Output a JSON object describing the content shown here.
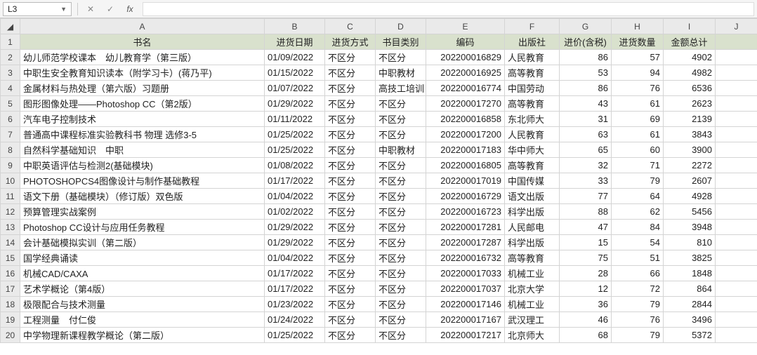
{
  "formula_bar": {
    "name_box": "L3",
    "cancel_glyph": "✕",
    "confirm_glyph": "✓",
    "fx_label": "fx",
    "formula_value": ""
  },
  "col_headers": [
    "A",
    "B",
    "C",
    "D",
    "E",
    "F",
    "G",
    "H",
    "I",
    "J"
  ],
  "data_header": [
    "书名",
    "进货日期",
    "进货方式",
    "书目类别",
    "编码",
    "出版社",
    "进价(含税)",
    "进货数量",
    "金额总计"
  ],
  "rows": [
    {
      "n": 2,
      "name": "幼儿师范学校课本　幼儿教育学（第三版）",
      "date": "01/09/2022",
      "way": "不区分",
      "cat": "不区分",
      "code": "202200016829",
      "pub": "人民教育",
      "price": 86,
      "qty": 57,
      "total": 4902
    },
    {
      "n": 3,
      "name": "中职生安全教育知识读本（附学习卡）(蒋乃平)",
      "date": "01/15/2022",
      "way": "不区分",
      "cat": "中职教材",
      "code": "202200016925",
      "pub": "高等教育",
      "price": 53,
      "qty": 94,
      "total": 4982
    },
    {
      "n": 4,
      "name": "金属材料与热处理（第六版）习题册",
      "date": "01/07/2022",
      "way": "不区分",
      "cat": "高技工培训",
      "code": "202200016774",
      "pub": "中国劳动",
      "price": 86,
      "qty": 76,
      "total": 6536
    },
    {
      "n": 5,
      "name": "图形图像处理——Photoshop CC（第2版）",
      "date": "01/29/2022",
      "way": "不区分",
      "cat": "不区分",
      "code": "202200017270",
      "pub": "高等教育",
      "price": 43,
      "qty": 61,
      "total": 2623
    },
    {
      "n": 6,
      "name": "汽车电子控制技术",
      "date": "01/11/2022",
      "way": "不区分",
      "cat": "不区分",
      "code": "202200016858",
      "pub": "东北师大",
      "price": 31,
      "qty": 69,
      "total": 2139
    },
    {
      "n": 7,
      "name": "普通高中课程标准实验教科书 物理 选修3-5",
      "date": "01/25/2022",
      "way": "不区分",
      "cat": "不区分",
      "code": "202200017200",
      "pub": "人民教育",
      "price": 63,
      "qty": 61,
      "total": 3843
    },
    {
      "n": 8,
      "name": "自然科学基础知识　中职",
      "date": "01/25/2022",
      "way": "不区分",
      "cat": "中职教材",
      "code": "202200017183",
      "pub": "华中师大",
      "price": 65,
      "qty": 60,
      "total": 3900
    },
    {
      "n": 9,
      "name": "中职英语评估与检测2(基础模块)",
      "date": "01/08/2022",
      "way": "不区分",
      "cat": "不区分",
      "code": "202200016805",
      "pub": "高等教育",
      "price": 32,
      "qty": 71,
      "total": 2272
    },
    {
      "n": 10,
      "name": "PHOTOSHOPCS4图像设计与制作基础教程",
      "date": "01/17/2022",
      "way": "不区分",
      "cat": "不区分",
      "code": "202200017019",
      "pub": "中国传媒",
      "price": 33,
      "qty": 79,
      "total": 2607
    },
    {
      "n": 11,
      "name": "语文下册（基础模块）（修订版）双色版",
      "date": "01/04/2022",
      "way": "不区分",
      "cat": "不区分",
      "code": "202200016729",
      "pub": "语文出版",
      "price": 77,
      "qty": 64,
      "total": 4928
    },
    {
      "n": 12,
      "name": "预算管理实战案例",
      "date": "01/02/2022",
      "way": "不区分",
      "cat": "不区分",
      "code": "202200016723",
      "pub": "科学出版",
      "price": 88,
      "qty": 62,
      "total": 5456
    },
    {
      "n": 13,
      "name": "Photoshop CC设计与应用任务教程",
      "date": "01/29/2022",
      "way": "不区分",
      "cat": "不区分",
      "code": "202200017281",
      "pub": "人民邮电",
      "price": 47,
      "qty": 84,
      "total": 3948
    },
    {
      "n": 14,
      "name": "会计基础模拟实训（第二版）",
      "date": "01/29/2022",
      "way": "不区分",
      "cat": "不区分",
      "code": "202200017287",
      "pub": "科学出版",
      "price": 15,
      "qty": 54,
      "total": 810
    },
    {
      "n": 15,
      "name": "国学经典诵读",
      "date": "01/04/2022",
      "way": "不区分",
      "cat": "不区分",
      "code": "202200016732",
      "pub": "高等教育",
      "price": 75,
      "qty": 51,
      "total": 3825
    },
    {
      "n": 16,
      "name": "机械CAD/CAXA",
      "date": "01/17/2022",
      "way": "不区分",
      "cat": "不区分",
      "code": "202200017033",
      "pub": "机械工业",
      "price": 28,
      "qty": 66,
      "total": 1848
    },
    {
      "n": 17,
      "name": "艺术学概论（第4版）",
      "date": "01/17/2022",
      "way": "不区分",
      "cat": "不区分",
      "code": "202200017037",
      "pub": "北京大学",
      "price": 12,
      "qty": 72,
      "total": 864
    },
    {
      "n": 18,
      "name": "极限配合与技术测量",
      "date": "01/23/2022",
      "way": "不区分",
      "cat": "不区分",
      "code": "202200017146",
      "pub": "机械工业",
      "price": 36,
      "qty": 79,
      "total": 2844
    },
    {
      "n": 19,
      "name": "工程测量　付仁俊",
      "date": "01/24/2022",
      "way": "不区分",
      "cat": "不区分",
      "code": "202200017167",
      "pub": "武汉理工",
      "price": 46,
      "qty": 76,
      "total": 3496
    },
    {
      "n": 20,
      "name": "中学物理新课程教学概论（第二版）",
      "date": "01/25/2022",
      "way": "不区分",
      "cat": "不区分",
      "code": "202200017217",
      "pub": "北京师大",
      "price": 68,
      "qty": 79,
      "total": 5372
    }
  ],
  "chart_data": {
    "type": "table",
    "title": "",
    "columns": [
      "书名",
      "进货日期",
      "进货方式",
      "书目类别",
      "编码",
      "出版社",
      "进价(含税)",
      "进货数量",
      "金额总计"
    ],
    "rows": [
      [
        "幼儿师范学校课本　幼儿教育学（第三版）",
        "01/09/2022",
        "不区分",
        "不区分",
        "202200016829",
        "人民教育",
        86,
        57,
        4902
      ],
      [
        "中职生安全教育知识读本（附学习卡）(蒋乃平)",
        "01/15/2022",
        "不区分",
        "中职教材",
        "202200016925",
        "高等教育",
        53,
        94,
        4982
      ],
      [
        "金属材料与热处理（第六版）习题册",
        "01/07/2022",
        "不区分",
        "高技工培训",
        "202200016774",
        "中国劳动",
        86,
        76,
        6536
      ],
      [
        "图形图像处理——Photoshop CC（第2版）",
        "01/29/2022",
        "不区分",
        "不区分",
        "202200017270",
        "高等教育",
        43,
        61,
        2623
      ],
      [
        "汽车电子控制技术",
        "01/11/2022",
        "不区分",
        "不区分",
        "202200016858",
        "东北师大",
        31,
        69,
        2139
      ],
      [
        "普通高中课程标准实验教科书 物理 选修3-5",
        "01/25/2022",
        "不区分",
        "不区分",
        "202200017200",
        "人民教育",
        63,
        61,
        3843
      ],
      [
        "自然科学基础知识　中职",
        "01/25/2022",
        "不区分",
        "中职教材",
        "202200017183",
        "华中师大",
        65,
        60,
        3900
      ],
      [
        "中职英语评估与检测2(基础模块)",
        "01/08/2022",
        "不区分",
        "不区分",
        "202200016805",
        "高等教育",
        32,
        71,
        2272
      ],
      [
        "PHOTOSHOPCS4图像设计与制作基础教程",
        "01/17/2022",
        "不区分",
        "不区分",
        "202200017019",
        "中国传媒",
        33,
        79,
        2607
      ],
      [
        "语文下册（基础模块）（修订版）双色版",
        "01/04/2022",
        "不区分",
        "不区分",
        "202200016729",
        "语文出版",
        77,
        64,
        4928
      ],
      [
        "预算管理实战案例",
        "01/02/2022",
        "不区分",
        "不区分",
        "202200016723",
        "科学出版",
        88,
        62,
        5456
      ],
      [
        "Photoshop CC设计与应用任务教程",
        "01/29/2022",
        "不区分",
        "不区分",
        "202200017281",
        "人民邮电",
        47,
        84,
        3948
      ],
      [
        "会计基础模拟实训（第二版）",
        "01/29/2022",
        "不区分",
        "不区分",
        "202200017287",
        "科学出版",
        15,
        54,
        810
      ],
      [
        "国学经典诵读",
        "01/04/2022",
        "不区分",
        "不区分",
        "202200016732",
        "高等教育",
        75,
        51,
        3825
      ],
      [
        "机械CAD/CAXA",
        "01/17/2022",
        "不区分",
        "不区分",
        "202200017033",
        "机械工业",
        28,
        66,
        1848
      ],
      [
        "艺术学概论（第4版）",
        "01/17/2022",
        "不区分",
        "不区分",
        "202200017037",
        "北京大学",
        12,
        72,
        864
      ],
      [
        "极限配合与技术测量",
        "01/23/2022",
        "不区分",
        "不区分",
        "202200017146",
        "机械工业",
        36,
        79,
        2844
      ],
      [
        "工程测量　付仁俊",
        "01/24/2022",
        "不区分",
        "不区分",
        "202200017167",
        "武汉理工",
        46,
        76,
        3496
      ],
      [
        "中学物理新课程教学概论（第二版）",
        "01/25/2022",
        "不区分",
        "不区分",
        "202200017217",
        "北京师大",
        68,
        79,
        5372
      ]
    ]
  }
}
